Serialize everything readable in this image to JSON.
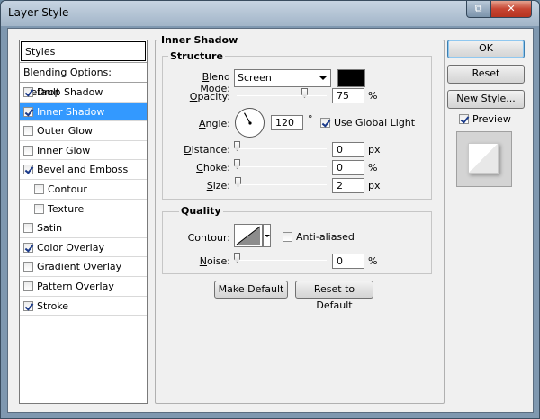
{
  "window": {
    "title": "Layer Style",
    "restore_glyph": "⧉",
    "close_glyph": "✕"
  },
  "styles_panel": {
    "header": "Styles",
    "blending_options": "Blending Options: Default",
    "items": [
      {
        "label": "Drop Shadow",
        "checked": true,
        "sub": false,
        "selected": false
      },
      {
        "label": "Inner Shadow",
        "checked": true,
        "sub": false,
        "selected": true
      },
      {
        "label": "Outer Glow",
        "checked": false,
        "sub": false,
        "selected": false
      },
      {
        "label": "Inner Glow",
        "checked": false,
        "sub": false,
        "selected": false
      },
      {
        "label": "Bevel and Emboss",
        "checked": true,
        "sub": false,
        "selected": false
      },
      {
        "label": "Contour",
        "checked": false,
        "sub": true,
        "selected": false
      },
      {
        "label": "Texture",
        "checked": false,
        "sub": true,
        "selected": false
      },
      {
        "label": "Satin",
        "checked": false,
        "sub": false,
        "selected": false
      },
      {
        "label": "Color Overlay",
        "checked": true,
        "sub": false,
        "selected": false
      },
      {
        "label": "Gradient Overlay",
        "checked": false,
        "sub": false,
        "selected": false
      },
      {
        "label": "Pattern Overlay",
        "checked": false,
        "sub": false,
        "selected": false
      },
      {
        "label": "Stroke",
        "checked": true,
        "sub": false,
        "selected": false
      }
    ]
  },
  "inner_shadow": {
    "title": "Inner Shadow",
    "structure": {
      "title": "Structure",
      "blend_mode_label": "Blend Mode:",
      "blend_mode_value": "Screen",
      "blend_color": "#000000",
      "opacity_label": "Opacity:",
      "opacity_value": "75",
      "opacity_unit": "%",
      "angle_label": "Angle:",
      "angle_value": "120",
      "angle_unit": "°",
      "use_global_light_label": "Use Global Light",
      "use_global_light_checked": true,
      "distance_label": "Distance:",
      "distance_value": "0",
      "distance_unit": "px",
      "choke_label": "Choke:",
      "choke_value": "0",
      "choke_unit": "%",
      "size_label": "Size:",
      "size_value": "2",
      "size_unit": "px"
    },
    "quality": {
      "title": "Quality",
      "contour_label": "Contour:",
      "anti_aliased_label": "Anti-aliased",
      "anti_aliased_checked": false,
      "noise_label": "Noise:",
      "noise_value": "0",
      "noise_unit": "%"
    },
    "make_default_label": "Make Default",
    "reset_to_default_label": "Reset to Default"
  },
  "actions": {
    "ok_label": "OK",
    "reset_label": "Reset",
    "new_style_label": "New Style...",
    "preview_label": "Preview",
    "preview_checked": true
  }
}
